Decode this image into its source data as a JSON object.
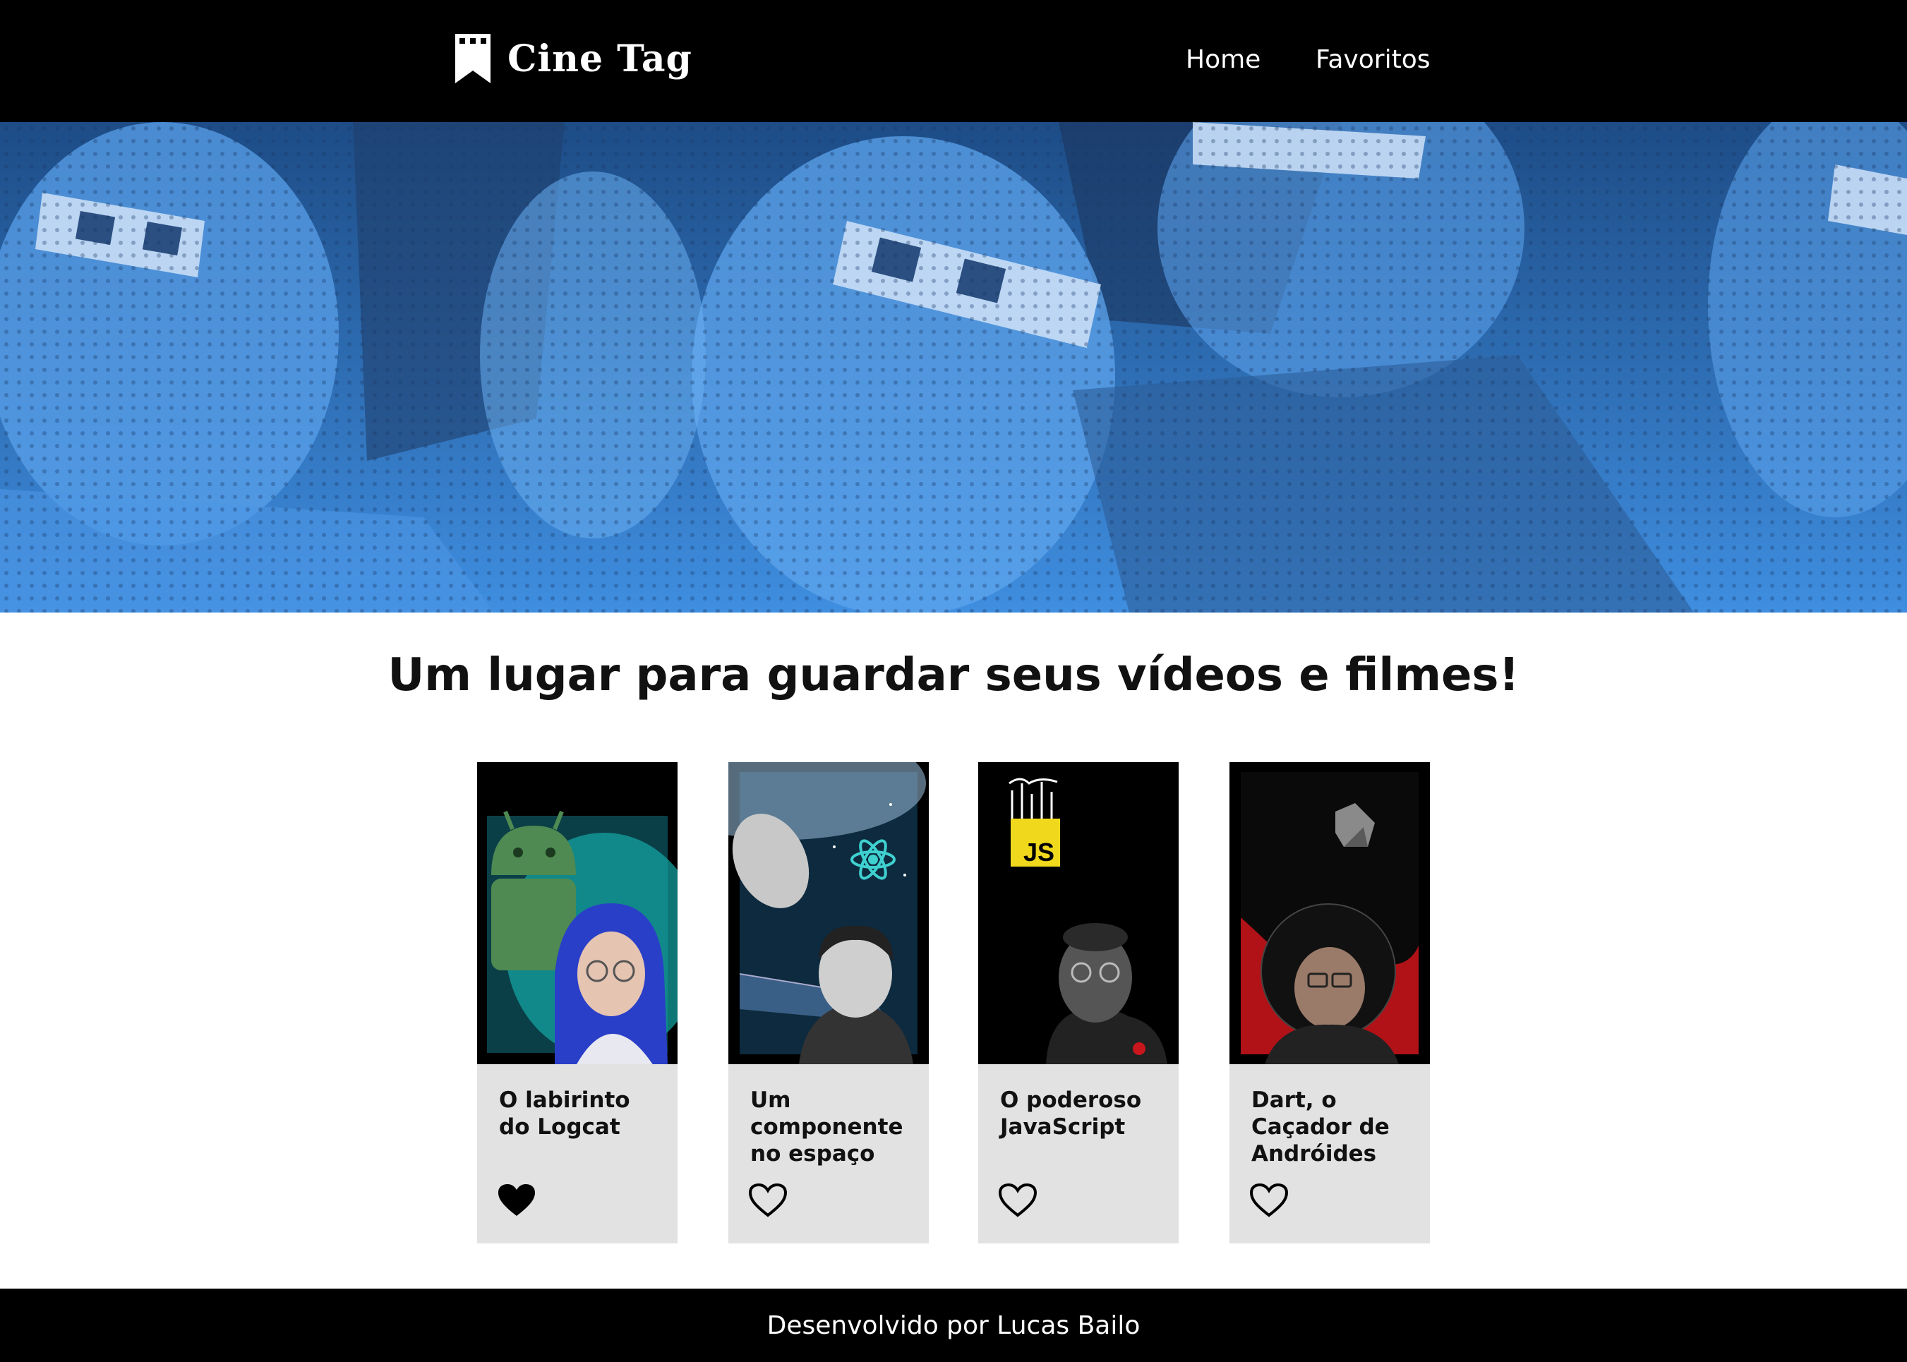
{
  "header": {
    "brand": "Cine Tag",
    "nav": [
      {
        "label": "Home"
      },
      {
        "label": "Favoritos"
      }
    ]
  },
  "main": {
    "title": "Um lugar para guardar seus vídeos e filmes!"
  },
  "cards": [
    {
      "title": "O labirinto do Logcat",
      "favorited": true,
      "thumbnail_icon": "android-icon"
    },
    {
      "title": "Um componente no espaço",
      "favorited": false,
      "thumbnail_icon": "react-icon"
    },
    {
      "title": "O poderoso JavaScript",
      "favorited": false,
      "thumbnail_icon": "javascript-icon"
    },
    {
      "title": "Dart, o Caçador de Andróides",
      "favorited": false,
      "thumbnail_icon": "dart-icon"
    }
  ],
  "footer": {
    "text": "Desenvolvido por Lucas Bailo"
  },
  "colors": {
    "header_bg": "#000000",
    "banner_blue": "#3a86d8",
    "card_bg": "#e2e2e2"
  }
}
